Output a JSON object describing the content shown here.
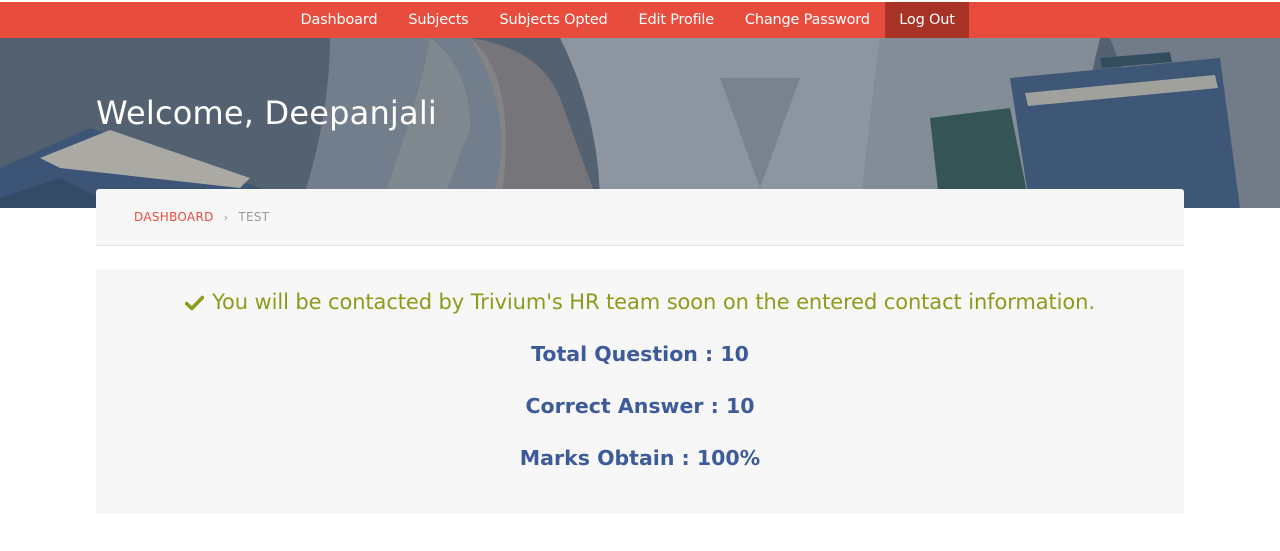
{
  "nav": {
    "items": [
      "Dashboard",
      "Subjects",
      "Subjects Opted",
      "Edit Profile",
      "Change Password",
      "Log Out"
    ],
    "active": "Log Out",
    "bg_color": "#e84c3d",
    "active_color": "#a93226"
  },
  "hero": {
    "title": "Welcome, Deepanjali"
  },
  "breadcrumb": {
    "link": "DASHBOARD",
    "separator": "›",
    "current": "TEST"
  },
  "result": {
    "message": "You will be contacted by Trivium's HR team soon on the entered contact information.",
    "message_icon": "check-icon",
    "message_color": "#8d9a1a",
    "total_question": "Total Question : 10",
    "correct_answer": "Correct Answer : 10",
    "marks_obtain": "Marks Obtain : 100%",
    "stat_color": "#3d5a99"
  }
}
